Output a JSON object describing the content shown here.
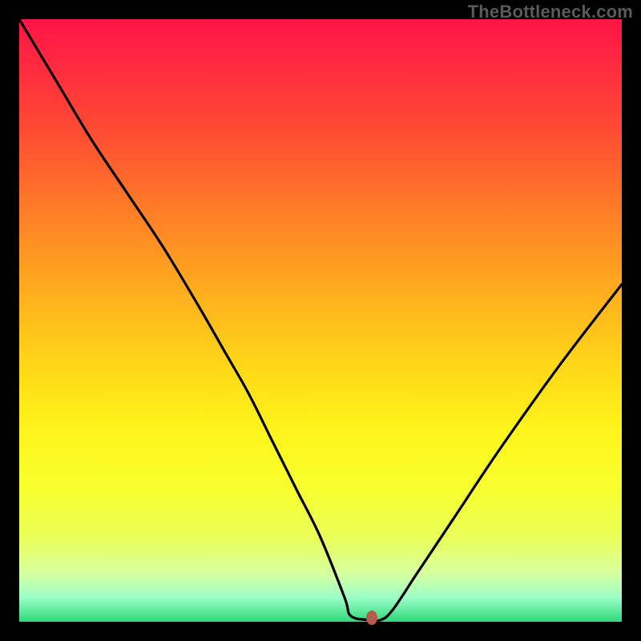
{
  "watermark": "TheBottleneck.com",
  "colors": {
    "page_bg": "#000000",
    "watermark": "#5a5a5a",
    "curve": "#000000",
    "marker": "#b85a4a",
    "gradient_top": "#ff1446",
    "gradient_bottom": "#2fd87a"
  },
  "chart_data": {
    "type": "line",
    "title": "",
    "xlabel": "",
    "ylabel": "",
    "xlim": [
      0,
      100
    ],
    "ylim": [
      0,
      100
    ],
    "grid": false,
    "legend": false,
    "series": [
      {
        "name": "curve",
        "x": [
          0,
          6,
          12,
          18,
          24,
          30,
          34,
          38,
          42,
          46,
          50,
          54,
          55,
          58,
          60,
          62,
          66,
          72,
          80,
          90,
          100
        ],
        "values": [
          100,
          90,
          80,
          71,
          62,
          52,
          45,
          38,
          30,
          22,
          14,
          4,
          1,
          0.3,
          0.3,
          2,
          8,
          17,
          29,
          43,
          56
        ]
      }
    ],
    "marker": {
      "x": 58.5,
      "y": 0.6
    },
    "notes": "No numeric axis ticks or labels are rendered in the image; values are visual estimates on a 0–100 normalized scale. Higher y = higher on the plot; background gradient runs red (top / high y) to green (bottom / low y)."
  }
}
